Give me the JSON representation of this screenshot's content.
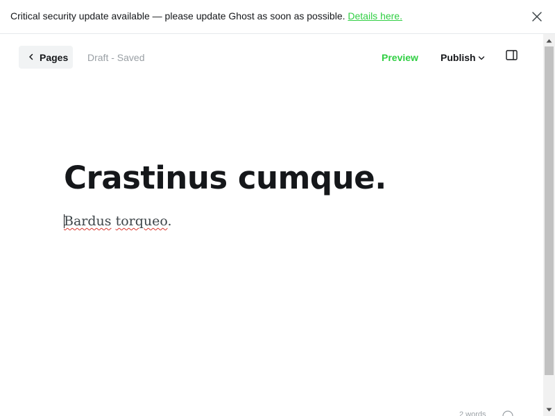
{
  "banner": {
    "message": "Critical security update available — please update Ghost as soon as possible.",
    "link_label": "Details here.",
    "close_icon": "close-icon"
  },
  "header": {
    "back_label": "Pages",
    "back_icon": "chevron-left-icon",
    "status": "Draft - Saved",
    "preview_label": "Preview",
    "publish_label": "Publish",
    "publish_icon": "chevron-down-icon",
    "sidebar_icon": "sidebar-toggle-icon"
  },
  "editor": {
    "title": "Crastinus cumque.",
    "body": "Bardus torqueo.",
    "body_words": [
      "Bardus",
      "torqueo"
    ],
    "body_end": "."
  },
  "footer": {
    "word_count_partial": "2 words",
    "help_icon": "help-icon"
  },
  "colors": {
    "accent": "#30cf43",
    "text": "#15171a",
    "muted": "#999fa4",
    "back_button_bg": "#f1f3f4"
  }
}
